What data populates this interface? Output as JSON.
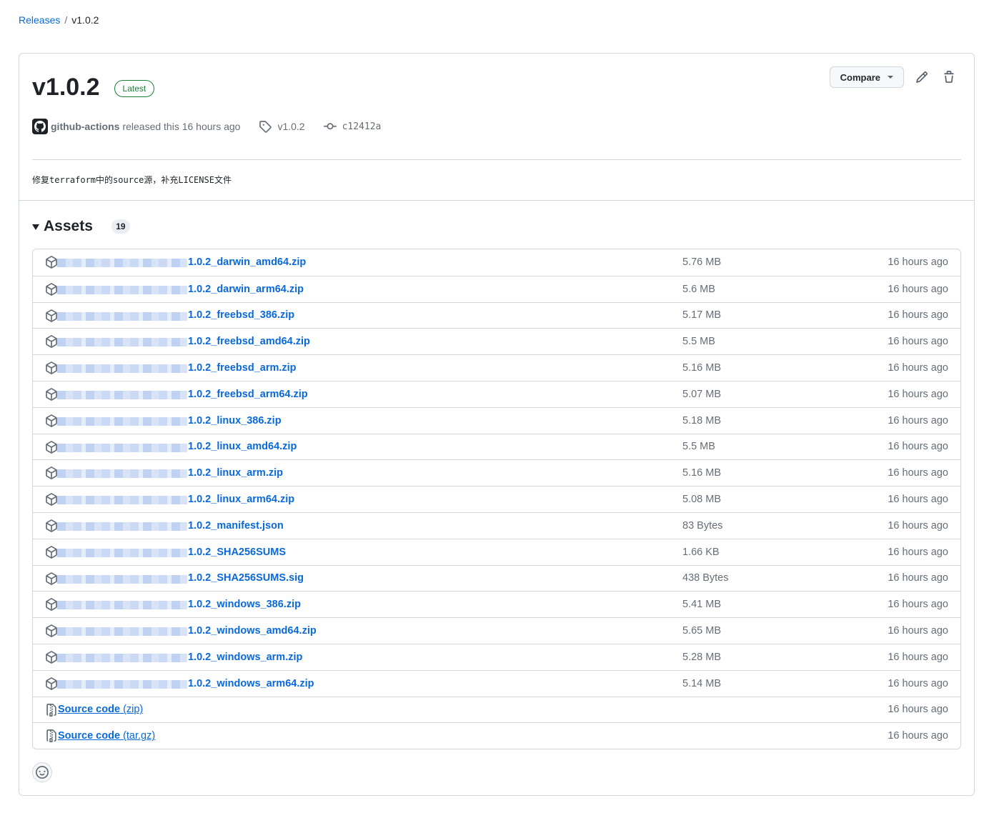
{
  "breadcrumb": {
    "parent": "Releases",
    "separator": "/",
    "current": "v1.0.2"
  },
  "release": {
    "title": "v1.0.2",
    "badge": "Latest",
    "author": "github-actions",
    "released_text": "released this 16 hours ago",
    "tag": "v1.0.2",
    "commit": "c12412a",
    "body": "修复terraform中的source源，补充LICENSE文件"
  },
  "actions": {
    "compare_label": "Compare"
  },
  "assets": {
    "title": "Assets",
    "count": "19",
    "items": [
      {
        "name": "1.0.2_darwin_amd64.zip",
        "size": "5.76 MB",
        "time": "16 hours ago"
      },
      {
        "name": "1.0.2_darwin_arm64.zip",
        "size": "5.6 MB",
        "time": "16 hours ago"
      },
      {
        "name": "1.0.2_freebsd_386.zip",
        "size": "5.17 MB",
        "time": "16 hours ago"
      },
      {
        "name": "1.0.2_freebsd_amd64.zip",
        "size": "5.5 MB",
        "time": "16 hours ago"
      },
      {
        "name": "1.0.2_freebsd_arm.zip",
        "size": "5.16 MB",
        "time": "16 hours ago"
      },
      {
        "name": "1.0.2_freebsd_arm64.zip",
        "size": "5.07 MB",
        "time": "16 hours ago"
      },
      {
        "name": "1.0.2_linux_386.zip",
        "size": "5.18 MB",
        "time": "16 hours ago"
      },
      {
        "name": "1.0.2_linux_amd64.zip",
        "size": "5.5 MB",
        "time": "16 hours ago"
      },
      {
        "name": "1.0.2_linux_arm.zip",
        "size": "5.16 MB",
        "time": "16 hours ago"
      },
      {
        "name": "1.0.2_linux_arm64.zip",
        "size": "5.08 MB",
        "time": "16 hours ago"
      },
      {
        "name": "1.0.2_manifest.json",
        "size": "83 Bytes",
        "time": "16 hours ago"
      },
      {
        "name": "1.0.2_SHA256SUMS",
        "size": "1.66 KB",
        "time": "16 hours ago"
      },
      {
        "name": "1.0.2_SHA256SUMS.sig",
        "size": "438 Bytes",
        "time": "16 hours ago"
      },
      {
        "name": "1.0.2_windows_386.zip",
        "size": "5.41 MB",
        "time": "16 hours ago"
      },
      {
        "name": "1.0.2_windows_amd64.zip",
        "size": "5.65 MB",
        "time": "16 hours ago"
      },
      {
        "name": "1.0.2_windows_arm.zip",
        "size": "5.28 MB",
        "time": "16 hours ago"
      },
      {
        "name": "1.0.2_windows_arm64.zip",
        "size": "5.14 MB",
        "time": "16 hours ago"
      }
    ],
    "sources": [
      {
        "label": "Source code",
        "format": "(zip)",
        "time": "16 hours ago"
      },
      {
        "label": "Source code",
        "format": "(tar.gz)",
        "time": "16 hours ago"
      }
    ]
  },
  "icons": {
    "asset": "package-icon",
    "source": "file-zip-icon",
    "tag": "tag-icon",
    "commit": "git-commit-icon",
    "edit": "pencil-icon",
    "delete": "trash-icon",
    "reaction": "smiley-icon"
  },
  "colors": {
    "link": "#0969da",
    "latest": "#1a7f37",
    "muted": "#656d76",
    "border": "#d0d7de"
  }
}
